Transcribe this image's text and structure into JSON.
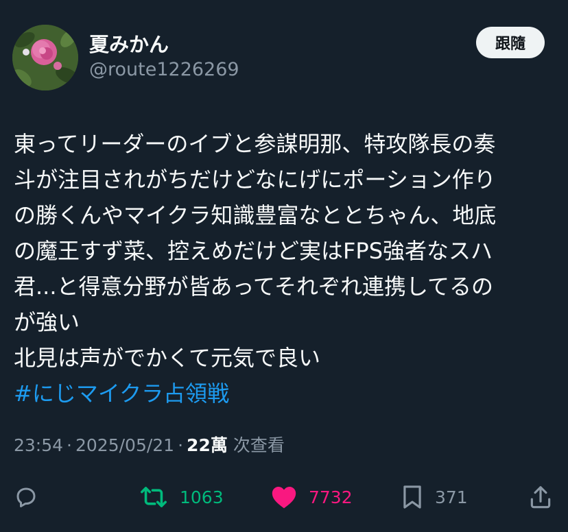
{
  "user": {
    "display_name": "夏みかん",
    "handle": "@route1226269",
    "avatar_icon": "rose-flower-avatar"
  },
  "follow_button": {
    "label": "跟隨"
  },
  "tweet": {
    "lines": [
      "東ってリーダーのイブと参謀明那、特攻隊長の奏",
      "斗が注目されがちだけどなにげにポーション作り",
      "の勝くんやマイクラ知識豊富なととちゃん、地底",
      "の魔王すず菜、控えめだけど実はFPS強者なスハ",
      "君...と得意分野が皆あってそれぞれ連携してるの",
      "が強い",
      "北見は声がでかくて元気で良い"
    ],
    "hashtag": "#にじマイクラ占領戦"
  },
  "meta": {
    "time": "23:54",
    "date": "2025/05/21",
    "separator": "·",
    "views": "22萬",
    "views_label": "次查看"
  },
  "actions": {
    "reply": {
      "icon": "reply-bubble-icon"
    },
    "retweet": {
      "icon": "retweet-icon",
      "count": "1063",
      "color": "#00ba7c"
    },
    "like": {
      "icon": "heart-icon",
      "count": "7732",
      "color": "#f91880"
    },
    "bookmark": {
      "icon": "bookmark-icon",
      "count": "371"
    },
    "share": {
      "icon": "share-icon"
    }
  },
  "colors": {
    "background": "#15202b",
    "text": "#f7f9f9",
    "secondary": "#8b98a5",
    "link": "#1d9bf0"
  }
}
